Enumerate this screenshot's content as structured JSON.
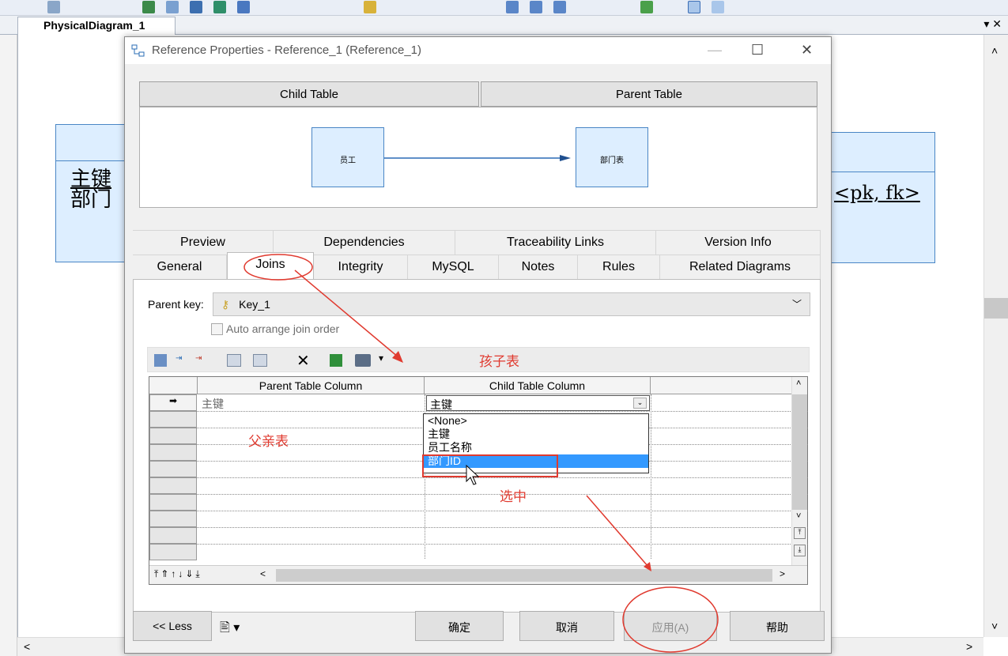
{
  "diagram": {
    "tab_title": "PhysicalDiagram_1",
    "left_entity": {
      "line1": "主键",
      "line2": "部门"
    },
    "right_entity": {
      "text": "<pk, fk>"
    }
  },
  "dialog": {
    "title": "Reference Properties - Reference_1 (Reference_1)",
    "header": {
      "child_table": "Child Table",
      "parent_table": "Parent Table"
    },
    "preview": {
      "child_name": "员工",
      "parent_name": "部门表"
    },
    "tabs_row1": [
      "Preview",
      "Dependencies",
      "Traceability Links",
      "Version Info"
    ],
    "tabs_row2": [
      "General",
      "Joins",
      "Integrity",
      "MySQL",
      "Notes",
      "Rules",
      "Related Diagrams"
    ],
    "active_tab": "Joins",
    "parent_key": {
      "label": "Parent key:",
      "value": "Key_1"
    },
    "auto_arrange": "Auto arrange join order",
    "grid": {
      "columns": [
        "Parent Table Column",
        "Child Table Column"
      ],
      "row1": {
        "parent": "主键",
        "child": "主键"
      },
      "dropdown_options": [
        "<None>",
        "主键",
        "员工名称",
        "部门ID"
      ],
      "selected_option": "部门ID"
    },
    "annotations": {
      "child": "孩子表",
      "parent": "父亲表",
      "selected": "选中"
    },
    "buttons": {
      "less": "<< Less",
      "ok": "确定",
      "cancel": "取消",
      "apply": "应用(A)",
      "help": "帮助"
    }
  },
  "colors": {
    "accent_red": "#e03a2f",
    "entity_fill": "#ddeeff",
    "selection": "#3399ff"
  }
}
